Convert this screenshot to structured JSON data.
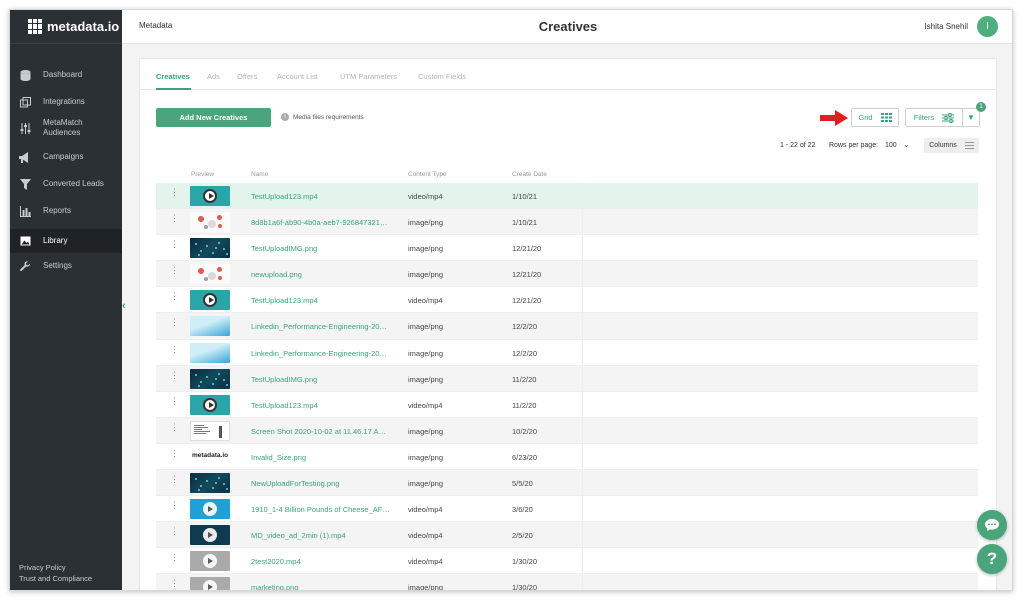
{
  "app": {
    "logo_text": "metadata.io"
  },
  "sidebar": {
    "items": [
      {
        "label": "Dashboard",
        "icon": "database-icon"
      },
      {
        "label": "Integrations",
        "icon": "integrations-icon"
      },
      {
        "label": "MetaMatch\nAudiences",
        "icon": "sliders-icon"
      },
      {
        "label": "Campaigns",
        "icon": "megaphone-icon"
      },
      {
        "label": "Converted Leads",
        "icon": "funnel-icon"
      },
      {
        "label": "Reports",
        "icon": "bar-chart-icon"
      },
      {
        "label": "Library",
        "icon": "image-icon",
        "active": true
      },
      {
        "label": "Settings",
        "icon": "wrench-icon"
      }
    ],
    "footer": {
      "privacy": "Privacy Policy",
      "trust": "Trust and Compliance"
    }
  },
  "header": {
    "breadcrumb": "Metadata",
    "title": "Creatives",
    "user_name": "Ishita Snehil",
    "avatar_initial": "I"
  },
  "tabs": [
    "Creatives",
    "Ads",
    "Offers",
    "Account List",
    "UTM Parameters",
    "Custom Fields"
  ],
  "toolbar": {
    "add_label": "Add New Creatives",
    "media_requirements": "Media files requirements",
    "grid_label": "Grid",
    "filters_label": "Filters",
    "filter_badge": "1",
    "page_range": "1 - 22 of 22",
    "rows_per_page_label": "Rows per page:",
    "rows_per_page_value": "100",
    "columns_label": "Columns"
  },
  "table": {
    "headers": [
      "Preview",
      "Name",
      "Content Type",
      "Create Date"
    ],
    "rows": [
      {
        "name": "TestUpload123.mp4",
        "type": "video/mp4",
        "date": "1/10/21",
        "thumb": "video"
      },
      {
        "name": "8d8b1a6f-ab90-4b0a-aeb7-926847321…",
        "type": "image/png",
        "date": "1/10/21",
        "thumb": "infog"
      },
      {
        "name": "TestUploadIMG.png",
        "type": "image/png",
        "date": "12/21/20",
        "thumb": "dark"
      },
      {
        "name": "newupload.png",
        "type": "image/png",
        "date": "12/21/20",
        "thumb": "infog"
      },
      {
        "name": "TestUpload123.mp4",
        "type": "video/mp4",
        "date": "12/21/20",
        "thumb": "video"
      },
      {
        "name": "Linkedin_Performance-Engineering-20…",
        "type": "image/png",
        "date": "12/2/20",
        "thumb": "linked"
      },
      {
        "name": "Linkedin_Performance-Engineering-20…",
        "type": "image/png",
        "date": "12/2/20",
        "thumb": "linked"
      },
      {
        "name": "TestUploadIMG.png",
        "type": "image/png",
        "date": "11/2/20",
        "thumb": "dark"
      },
      {
        "name": "TestUpload123.mp4",
        "type": "video/mp4",
        "date": "11/2/20",
        "thumb": "video"
      },
      {
        "name": "Screen Shot 2020-10-02 at 11.46.17 A…",
        "type": "image/png",
        "date": "10/2/20",
        "thumb": "screen"
      },
      {
        "name": "Invalid_Size.png",
        "type": "image/png",
        "date": "6/23/20",
        "thumb": "meta"
      },
      {
        "name": "NewUploadForTesting.png",
        "type": "image/png",
        "date": "5/5/20",
        "thumb": "dark"
      },
      {
        "name": "1910_1-4 Billion Pounds of Cheese_AF…",
        "type": "video/mp4",
        "date": "3/6/20",
        "thumb": "cheese"
      },
      {
        "name": "MD_video_ad_2min (1).mp4",
        "type": "video/mp4",
        "date": "2/5/20",
        "thumb": "md"
      },
      {
        "name": "2test2020.mp4",
        "type": "video/mp4",
        "date": "1/30/20",
        "thumb": "gray"
      },
      {
        "name": "marketing.png",
        "type": "image/png",
        "date": "1/30/20",
        "thumb": "gray"
      }
    ]
  },
  "colors": {
    "accent": "#4ba57c",
    "sidebar": "#2b3034",
    "arrow": "#e02020",
    "selected_row": "#e3f4ec"
  }
}
